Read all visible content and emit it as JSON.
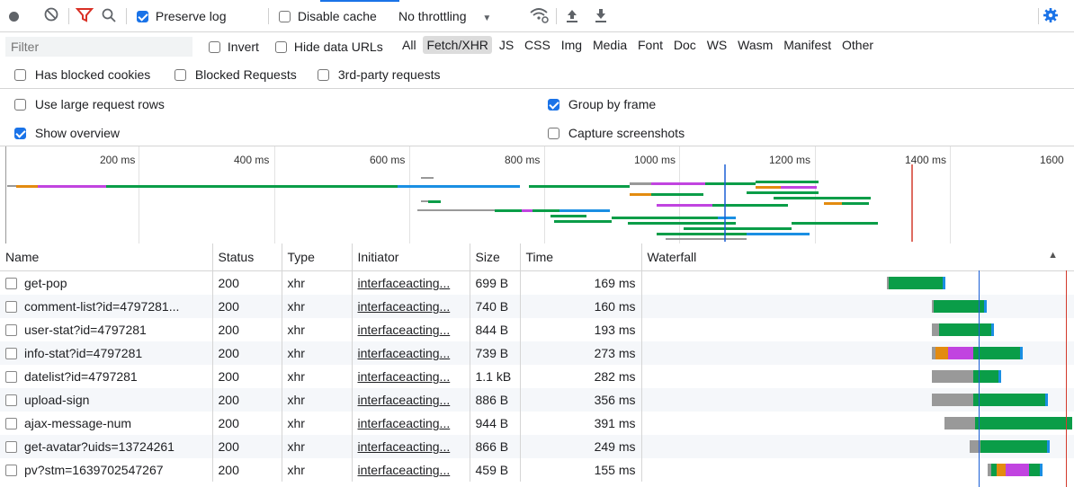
{
  "toolbar": {
    "preserve_log": "Preserve log",
    "disable_cache": "Disable cache",
    "throttling": "No throttling"
  },
  "filter": {
    "placeholder": "Filter",
    "invert": "Invert",
    "hide_data_urls": "Hide data URLs",
    "types": [
      "All",
      "Fetch/XHR",
      "JS",
      "CSS",
      "Img",
      "Media",
      "Font",
      "Doc",
      "WS",
      "Wasm",
      "Manifest",
      "Other"
    ],
    "active_type": "Fetch/XHR"
  },
  "filter2": {
    "has_blocked_cookies": "Has blocked cookies",
    "blocked_requests": "Blocked Requests",
    "third_party": "3rd-party requests"
  },
  "settings": {
    "large_rows": "Use large request rows",
    "show_overview": "Show overview",
    "group_by_frame": "Group by frame",
    "capture_screenshots": "Capture screenshots"
  },
  "overview": {
    "ticks": [
      "200 ms",
      "400 ms",
      "600 ms",
      "800 ms",
      "1000 ms",
      "1200 ms",
      "1400 ms",
      "1600"
    ]
  },
  "table": {
    "headers": {
      "name": "Name",
      "status": "Status",
      "type": "Type",
      "initiator": "Initiator",
      "size": "Size",
      "time": "Time",
      "waterfall": "Waterfall",
      "sort": "▲"
    },
    "rows": [
      {
        "name": "get-pop",
        "status": "200",
        "type": "xhr",
        "initiator": "interfaceacting...",
        "size": "699 B",
        "time": "169 ms"
      },
      {
        "name": "comment-list?id=4797281...",
        "status": "200",
        "type": "xhr",
        "initiator": "interfaceacting...",
        "size": "740 B",
        "time": "160 ms"
      },
      {
        "name": "user-stat?id=4797281",
        "status": "200",
        "type": "xhr",
        "initiator": "interfaceacting...",
        "size": "844 B",
        "time": "193 ms"
      },
      {
        "name": "info-stat?id=4797281",
        "status": "200",
        "type": "xhr",
        "initiator": "interfaceacting...",
        "size": "739 B",
        "time": "273 ms"
      },
      {
        "name": "datelist?id=4797281",
        "status": "200",
        "type": "xhr",
        "initiator": "interfaceacting...",
        "size": "1.1 kB",
        "time": "282 ms"
      },
      {
        "name": "upload-sign",
        "status": "200",
        "type": "xhr",
        "initiator": "interfaceacting...",
        "size": "886 B",
        "time": "356 ms"
      },
      {
        "name": "ajax-message-num",
        "status": "200",
        "type": "xhr",
        "initiator": "interfaceacting...",
        "size": "944 B",
        "time": "391 ms"
      },
      {
        "name": "get-avatar?uids=13724261",
        "status": "200",
        "type": "xhr",
        "initiator": "interfaceacting...",
        "size": "866 B",
        "time": "249 ms"
      },
      {
        "name": "pv?stm=1639702547267",
        "status": "200",
        "type": "xhr",
        "initiator": "interfaceacting...",
        "size": "459 B",
        "time": "155 ms"
      }
    ]
  },
  "colors": {
    "waiting": "#0a9d48",
    "download": "#1a8fe3",
    "queue": "#999999",
    "ssl": "#c144e0",
    "connect": "#e38b10",
    "dom_line": "#1a5fd6",
    "load_line": "#d33a2c",
    "accent": "#1a73e8",
    "record": "#5f6368",
    "filter_red": "#d93025"
  }
}
